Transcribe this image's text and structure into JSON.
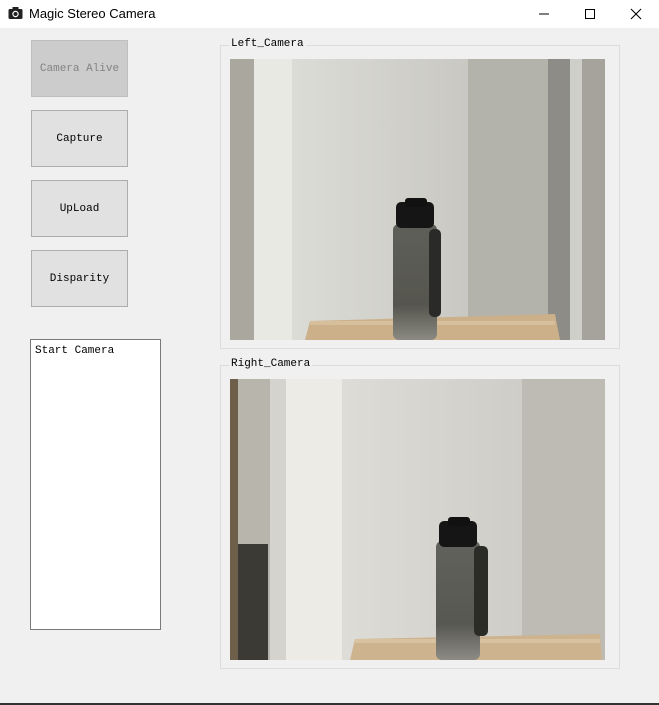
{
  "window": {
    "title": "Magic Stereo Camera",
    "controls": [
      "minimize-icon",
      "maximize-icon",
      "close-icon"
    ],
    "app_icon": "camera-icon"
  },
  "buttons": [
    {
      "label": "Camera Alive",
      "enabled": false
    },
    {
      "label": "Capture",
      "enabled": true
    },
    {
      "label": "UpLoad",
      "enabled": true
    },
    {
      "label": "Disparity",
      "enabled": true
    }
  ],
  "log": {
    "text": "Start Camera"
  },
  "cameras": {
    "left": {
      "label": "Left_Camera"
    },
    "right": {
      "label": "Right_Camera"
    }
  },
  "colors": {
    "window_bg": "#f0f0f0",
    "button_bg": "#e1e1e1",
    "disabled_button_bg": "#cccccc"
  }
}
